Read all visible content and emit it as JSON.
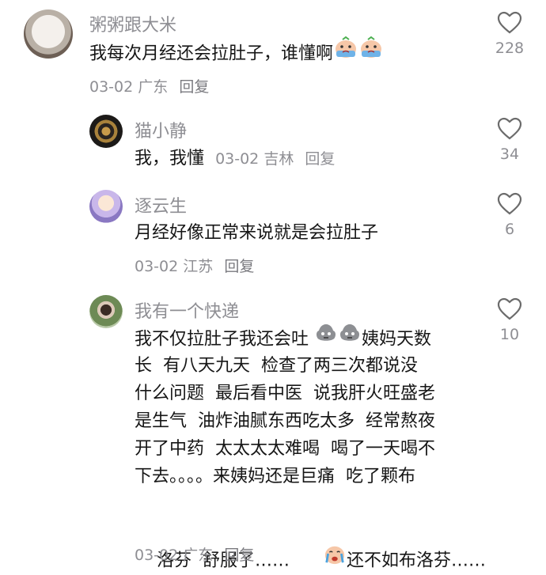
{
  "comments": [
    {
      "user": "粥粥跟大米",
      "text": "我每次月经还会拉肚子，谁懂啊",
      "date": "03-02",
      "location": "广东",
      "reply": "回复",
      "likes": "228",
      "avatar": "white-dog-photo",
      "emojis": [
        "crying-face-icon",
        "crying-face-icon"
      ]
    },
    {
      "user": "猫小静",
      "text": "我，我懂",
      "date": "03-02",
      "location": "吉林",
      "reply": "回复",
      "likes": "34",
      "avatar": "necklace-photo"
    },
    {
      "user": "逐云生",
      "text": "月经好像正常来说就是会拉肚子",
      "date": "03-02",
      "location": "江苏",
      "reply": "回复",
      "likes": "6",
      "avatar": "anime-girl"
    },
    {
      "user": "我有一个快递",
      "lines": [
        "我不仅拉肚子我还会吐",
        "姨妈天数",
        "长  有八天九天  检查了两三次都说没",
        "什么问题  最后看中医  说我肝火旺盛老",
        "是生气  油炸油腻东西吃太多  经常熬夜",
        "开了中药  太太太太难喝  喝了一天喝不",
        "下去。。。。来姨妈还是巨痛  吃了颗布",
        "洛芬  舒服了……",
        "还不如布洛芬……"
      ],
      "date": "03-02",
      "location": "广东",
      "reply": "回复",
      "likes": "10",
      "avatar": "girl-photo",
      "emojis": [
        "sweat-face-icon",
        "sweat-face-icon",
        "crying-face-icon"
      ]
    }
  ],
  "colors": {
    "text": "#161616",
    "secondary": "#8e8e93",
    "background": "#ffffff"
  }
}
